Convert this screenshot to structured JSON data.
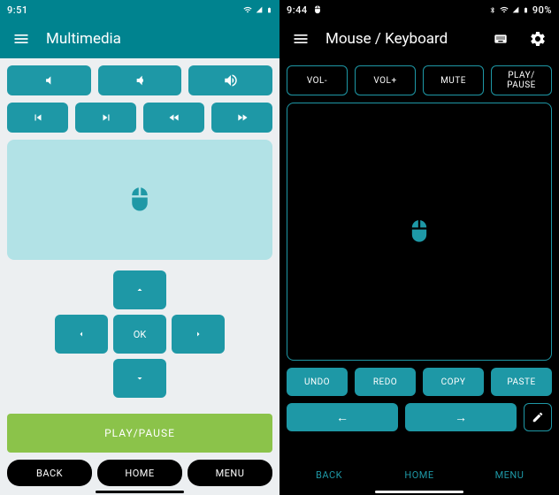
{
  "left": {
    "status_time": "9:51",
    "title": "Multimedia",
    "dpad_ok": "OK",
    "play_pause": "PLAY/PAUSE",
    "nav": {
      "back": "BACK",
      "home": "HOME",
      "menu": "MENU"
    }
  },
  "right": {
    "status_time": "9:44",
    "status_battery": "90%",
    "title": "Mouse / Keyboard",
    "top_buttons": [
      "VOL-",
      "VOL+",
      "MUTE",
      "PLAY/\nPAUSE"
    ],
    "clip_buttons": [
      "UNDO",
      "REDO",
      "COPY",
      "PASTE"
    ],
    "arrows": [
      "←",
      "→"
    ],
    "nav": {
      "back": "BACK",
      "home": "HOME",
      "menu": "MENU"
    }
  }
}
